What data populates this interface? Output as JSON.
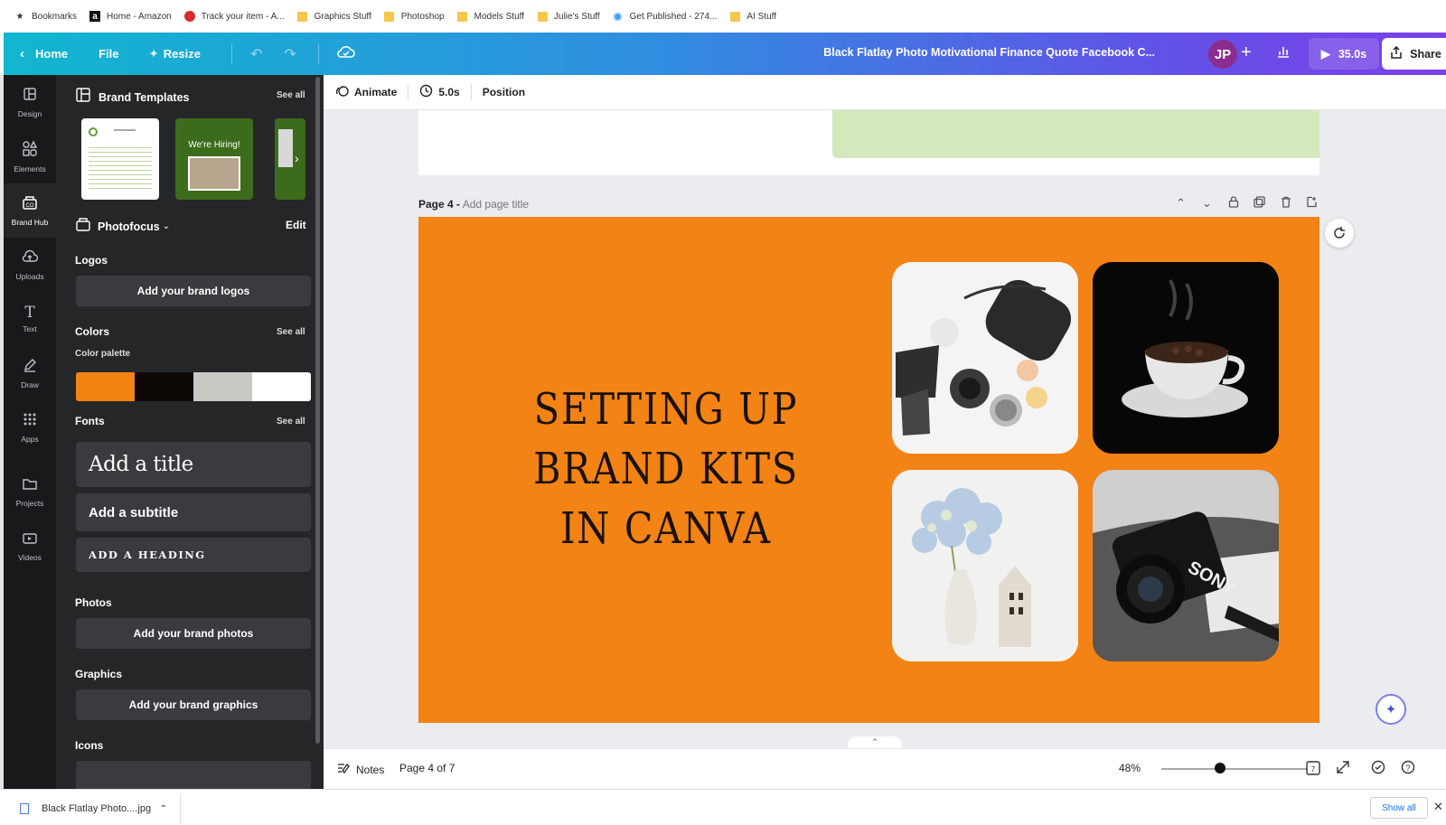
{
  "bookmarks": [
    {
      "label": "Bookmarks",
      "icon": "star-icon"
    },
    {
      "label": "Home - Amazon",
      "icon": "amazon-icon"
    },
    {
      "label": "Track your item - A...",
      "icon": "pin-icon"
    },
    {
      "label": "Graphics Stuff",
      "icon": "folder-icon"
    },
    {
      "label": "Photoshop",
      "icon": "folder-icon"
    },
    {
      "label": "Models Stuff",
      "icon": "folder-icon"
    },
    {
      "label": "Julie's Stuff",
      "icon": "folder-icon"
    },
    {
      "label": "Get Published - 274...",
      "icon": "globe-icon"
    },
    {
      "label": "AI Stuff",
      "icon": "folder-icon"
    }
  ],
  "topbar": {
    "home": "Home",
    "file": "File",
    "resize": "Resize",
    "title": "Black Flatlay Photo Motivational Finance Quote Facebook C...",
    "avatar": "JP",
    "present": "35.0s",
    "share": "Share"
  },
  "rail": [
    {
      "label": "Design",
      "icon": "layout-icon"
    },
    {
      "label": "Elements",
      "icon": "shapes-icon"
    },
    {
      "label": "Brand Hub",
      "icon": "brand-icon",
      "active": true
    },
    {
      "label": "Uploads",
      "icon": "upload-cloud-icon"
    },
    {
      "label": "Text",
      "icon": "text-icon"
    },
    {
      "label": "Draw",
      "icon": "pen-icon"
    },
    {
      "label": "Apps",
      "icon": "grid-icon"
    },
    {
      "label": "Projects",
      "icon": "folder-icon"
    },
    {
      "label": "Videos",
      "icon": "video-icon"
    }
  ],
  "panel": {
    "brand_templates": "Brand Templates",
    "see_all": "See all",
    "template2_text": "We're Hiring!",
    "kit_name": "Photofocus",
    "edit": "Edit",
    "logos": "Logos",
    "add_logos": "Add your brand logos",
    "colors": "Colors",
    "color_palette": "Color palette",
    "palette": [
      "#f58312",
      "#0e0906",
      "#c9c8c3",
      "#ffffff"
    ],
    "fonts": "Fonts",
    "add_title": "Add a title",
    "add_subtitle": "Add a subtitle",
    "add_heading": "ADD A HEADING",
    "photos": "Photos",
    "add_photos": "Add your brand photos",
    "graphics": "Graphics",
    "add_graphics": "Add your brand graphics",
    "icons": "Icons"
  },
  "ctx": {
    "animate": "Animate",
    "duration": "5.0s",
    "position": "Position"
  },
  "page": {
    "label": "Page 4 -",
    "placeholder": "Add page title",
    "headline": "SETTING UP BRAND KITS IN CANVA",
    "bg_color": "#f38314",
    "camera_brand": "SONY"
  },
  "status": {
    "notes": "Notes",
    "page_count": "Page 4 of 7",
    "zoom": "48%",
    "pages_badge": "7"
  },
  "download": {
    "file": "Black Flatlay Photo....jpg",
    "show_all": "Show all"
  }
}
